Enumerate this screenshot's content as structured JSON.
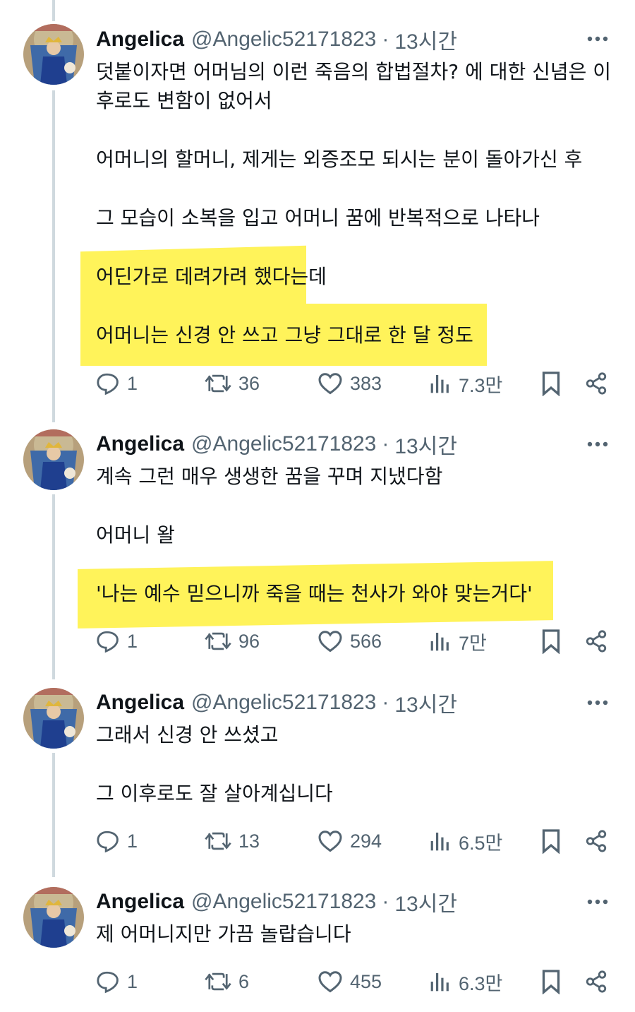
{
  "author": {
    "name": "Angelica",
    "handle": "@Angelic52171823",
    "separator": "·"
  },
  "more_label": "•••",
  "tweets": [
    {
      "time": "13시간",
      "lines": [
        "덧붙이자면 어머님의 이런 죽음의 합법절차? 에 대한 신념은 이",
        "후로도 변함이 없어서",
        "어머니의 할머니, 제게는 외증조모 되시는 분이 돌아가신 후",
        "그 모습이 소복을 입고 어머니 꿈에 반복적으로 나타나",
        "어딘가로 데려가려 했다는데",
        "어머니는 신경 안 쓰고 그냥 그대로 한 달 정도"
      ],
      "stats": {
        "replies": "1",
        "retweets": "36",
        "likes": "383",
        "views": "7.3만"
      }
    },
    {
      "time": "13시간",
      "lines": [
        "계속 그런 매우 생생한 꿈을 꾸며 지냈다함",
        "어머니 왈",
        "'나는 예수 믿으니까 죽을 때는 천사가 와야 맞는거다'"
      ],
      "stats": {
        "replies": "1",
        "retweets": "96",
        "likes": "566",
        "views": "7만"
      }
    },
    {
      "time": "13시간",
      "lines": [
        "그래서 신경 안 쓰셨고",
        "그 이후로도 잘 살아계십니다"
      ],
      "stats": {
        "replies": "1",
        "retweets": "13",
        "likes": "294",
        "views": "6.5만"
      }
    },
    {
      "time": "13시간",
      "lines": [
        "제 어머니지만 가끔 놀랍습니다"
      ],
      "stats": {
        "replies": "1",
        "retweets": "6",
        "likes": "455",
        "views": "6.3만"
      }
    }
  ],
  "colors": {
    "highlight": "#fff35a",
    "muted": "#536471",
    "thread": "#cfd9de"
  },
  "icons": [
    "reply-icon",
    "retweet-icon",
    "like-icon",
    "views-icon",
    "bookmark-icon",
    "share-icon",
    "more-icon"
  ]
}
